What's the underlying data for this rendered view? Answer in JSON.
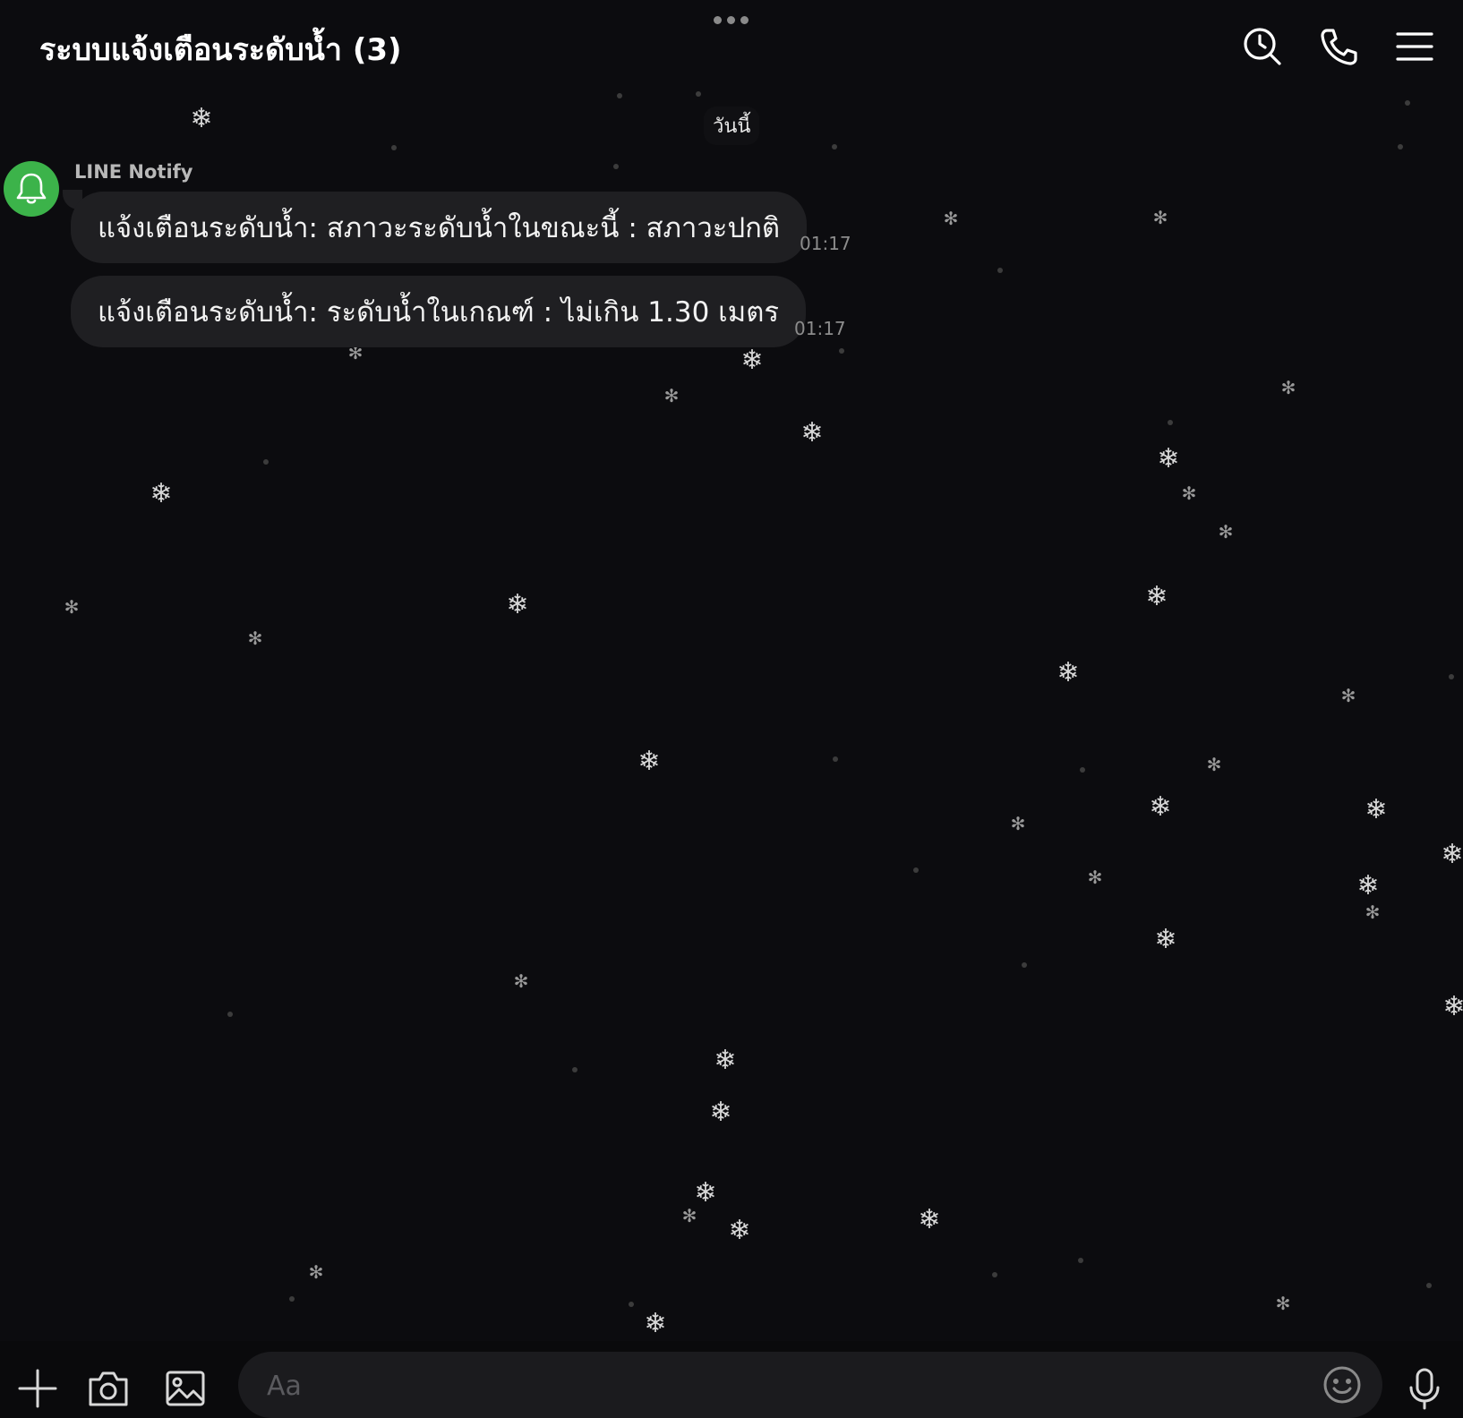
{
  "header": {
    "title": "ระบบแจ้งเตือนระดับน้ำ (3)",
    "icons": [
      "more-dots-icon",
      "search-history-icon",
      "phone-icon",
      "menu-icon"
    ]
  },
  "chat": {
    "date_label": "วันนี้",
    "sender": {
      "name": "LINE Notify",
      "avatar_icon": "bell-icon",
      "avatar_color": "#3cb34a"
    },
    "messages": [
      {
        "text": "แจ้งเตือนระดับน้ำ: สภาวะระดับน้ำในขณะนี้ : สภาวะปกติ",
        "time": "01:17"
      },
      {
        "text": "แจ้งเตือนระดับน้ำ: ระดับน้ำในเกณฑ์ : ไม่เกิน 1.30 เมตร",
        "time": "01:17"
      }
    ]
  },
  "composer": {
    "placeholder": "Aa",
    "icons": [
      "plus-icon",
      "camera-icon",
      "image-icon",
      "emoji-icon",
      "microphone-icon"
    ]
  },
  "colors": {
    "background": "#0c0c0f",
    "bubble": "#1f1f22",
    "accent_green": "#3cb34a"
  }
}
